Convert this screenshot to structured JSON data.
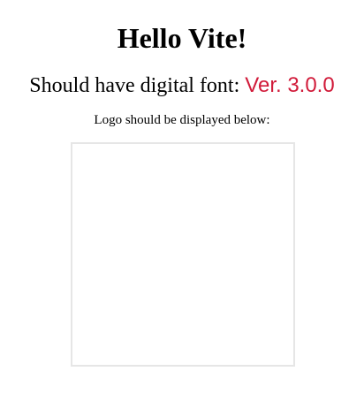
{
  "heading": {
    "title": "Hello Vite!"
  },
  "font_line": {
    "label": "Should have digital font:",
    "version": "Ver. 3.0.0"
  },
  "logo_section": {
    "note": "Logo should be displayed below:"
  },
  "colors": {
    "version_text": "#d11b3a",
    "frame_border": "#e6e6e6",
    "background": "#ffffff"
  }
}
